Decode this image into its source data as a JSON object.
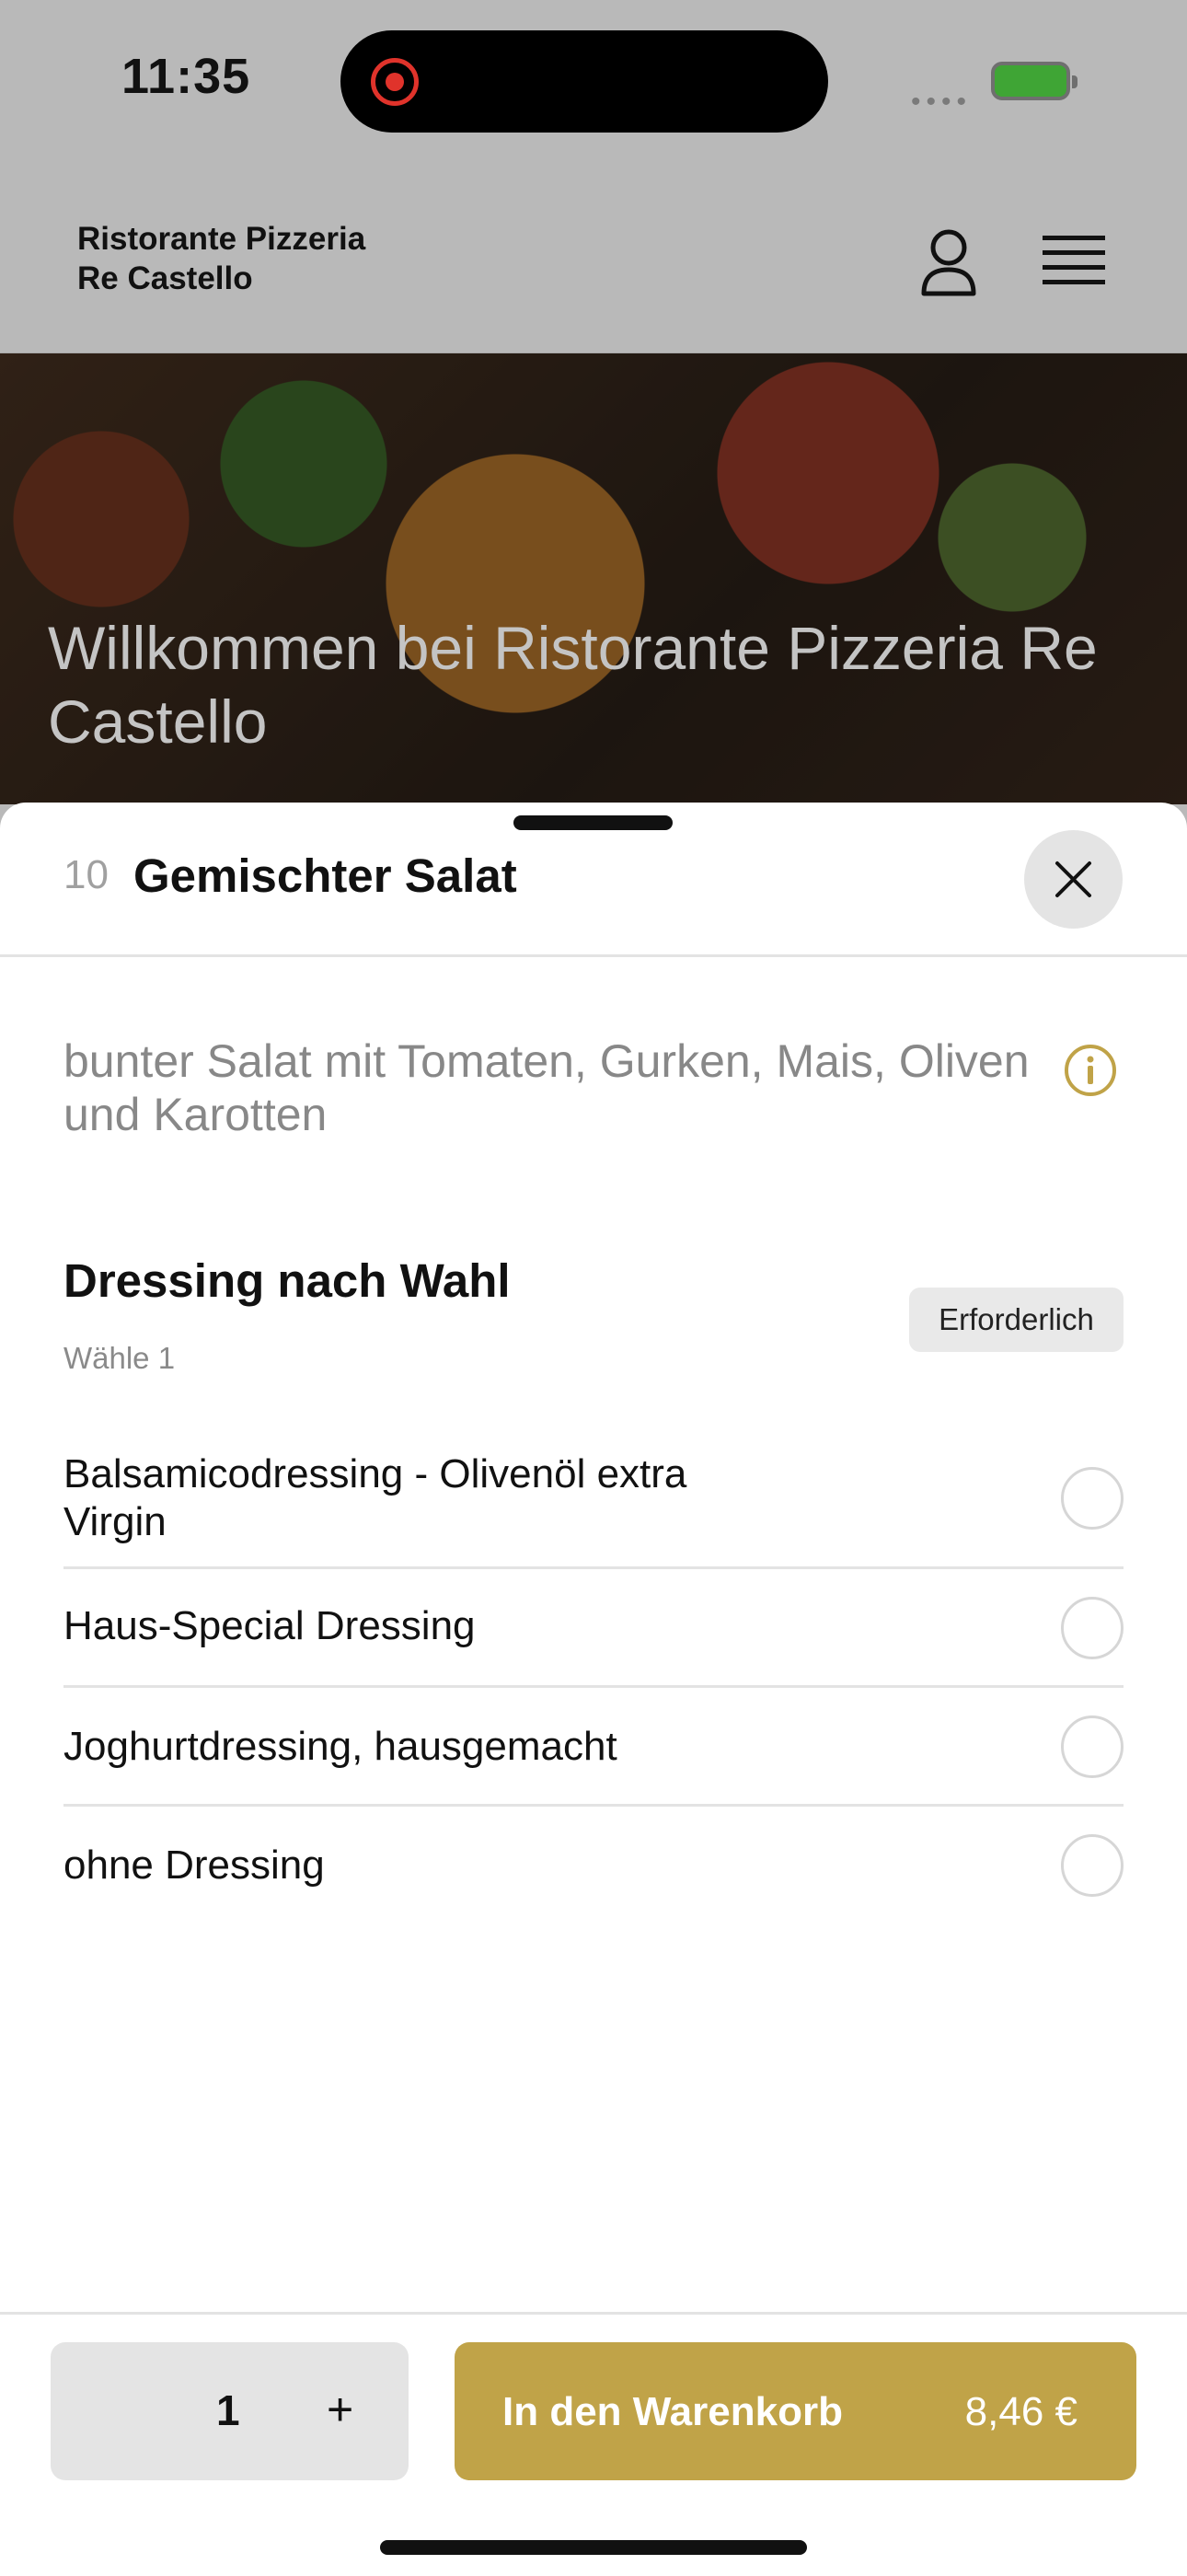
{
  "status_bar": {
    "time": "11:35",
    "signal": "••••"
  },
  "header": {
    "brand": "Ristorante Pizzeria\nRe Castello"
  },
  "hero": {
    "title": "Willkommen bei Ristorante Pizzeria Re Castello"
  },
  "sheet": {
    "item_number": "10",
    "item_title": "Gemischter Salat",
    "description": "bunter Salat mit Tomaten, Gurken, Mais, Oliven und Karotten",
    "group": {
      "title": "Dressing nach Wahl",
      "subtitle": "Wähle 1",
      "badge": "Erforderlich",
      "options": [
        {
          "label": "Balsamicodressing - Olivenöl extra Virgin",
          "selected": false
        },
        {
          "label": "Haus-Special Dressing",
          "selected": false
        },
        {
          "label": "Joghurtdressing, hausgemacht",
          "selected": false
        },
        {
          "label": "ohne Dressing",
          "selected": false
        }
      ]
    },
    "footer": {
      "quantity": "1",
      "plus": "+",
      "add_label": "In den Warenkorb",
      "price": "8,46 €"
    }
  },
  "colors": {
    "accent": "#c0a348",
    "battery": "#3fa535",
    "record": "#e0332b"
  }
}
